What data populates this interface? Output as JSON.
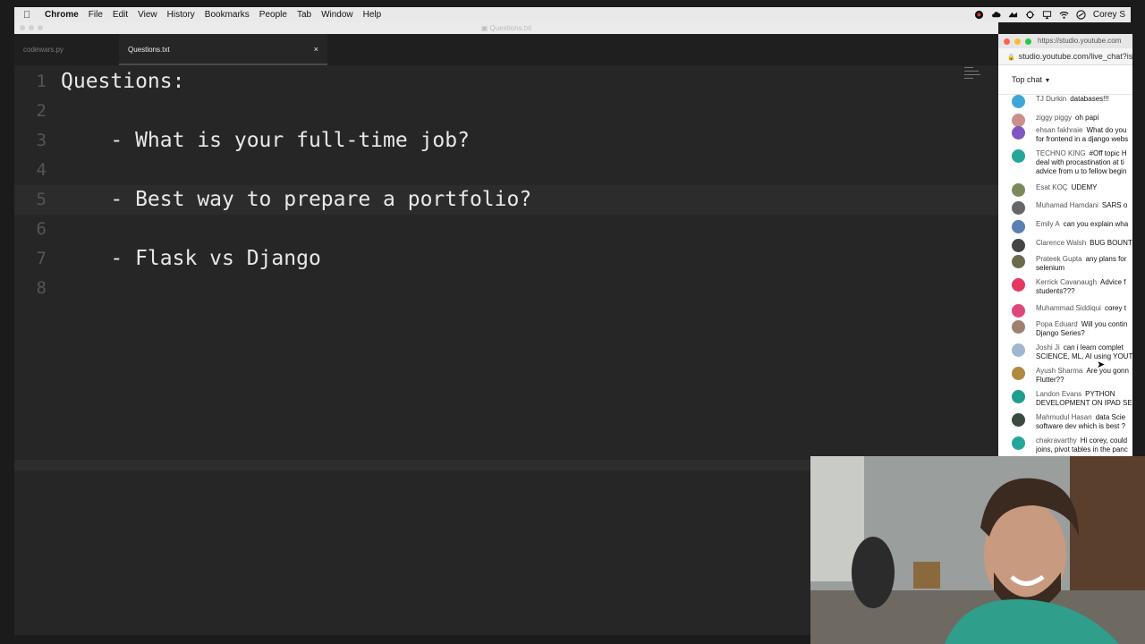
{
  "menubar": {
    "app": "Chrome",
    "items": [
      "File",
      "Edit",
      "View",
      "History",
      "Bookmarks",
      "People",
      "Tab",
      "Window",
      "Help"
    ],
    "user": "Corey S"
  },
  "window": {
    "title": "Questions.txt"
  },
  "tabs": [
    {
      "label": "codewars.py",
      "active": false
    },
    {
      "label": "Questions.txt",
      "active": true
    }
  ],
  "editor": {
    "lines": [
      {
        "num": "1",
        "text": "Questions:"
      },
      {
        "num": "2",
        "text": ""
      },
      {
        "num": "3",
        "text": "    - What is your full-time job?"
      },
      {
        "num": "4",
        "text": ""
      },
      {
        "num": "5",
        "text": "    - Best way to prepare a portfolio?"
      },
      {
        "num": "6",
        "text": ""
      },
      {
        "num": "7",
        "text": "    - Flask vs Django"
      },
      {
        "num": "8",
        "text": ""
      }
    ],
    "current_line": 5
  },
  "chat": {
    "window_url": "https://studio.youtube.com",
    "address": "studio.youtube.com/live_chat?is",
    "header": "Top chat",
    "messages": [
      {
        "author": "TJ Durkin",
        "text": "databases!!!",
        "color": "#3fa7d6"
      },
      {
        "author": "ziggy piggy",
        "text": "oh papi",
        "color": "#c98f8f"
      },
      {
        "author": "ehsan fakhraie",
        "text": "What do you",
        "text2": "for frontend in a django webs",
        "color": "#7e57c2"
      },
      {
        "author": "TECHNO KING",
        "text": "#Off topic H",
        "text2": "deal with procastination at ti",
        "text3": "advice from u to fellow begin",
        "color": "#26a69a"
      },
      {
        "author": "Esat KOÇ",
        "text": "UDEMY",
        "color": "#7a8a5a"
      },
      {
        "author": "Muhamad Hamdani",
        "text": "SARS o",
        "color": "#666666"
      },
      {
        "author": "Emily A",
        "text": "can you explain wha",
        "color": "#5a7fb0"
      },
      {
        "author": "Clarence Walsh",
        "text": "BUG BOUNT",
        "color": "#444444"
      },
      {
        "author": "Prateek Gupta",
        "text": "any plans for",
        "text2": "selenium",
        "color": "#6b6b4b"
      },
      {
        "author": "Kerrick Cavanaugh",
        "text": "Advice f",
        "text2": "students???",
        "color": "#e53961"
      },
      {
        "author": "Muhammad Siddiqui",
        "text": "corey t",
        "color": "#e0457b"
      },
      {
        "author": "Popa Eduard",
        "text": "Will you contin",
        "text2": "Django Series?",
        "color": "#a08070"
      },
      {
        "author": "Joshi Ji",
        "text": "can i learn complet",
        "text2": "SCIENCE, ML, AI using YOUT",
        "color": "#9fb6d0"
      },
      {
        "author": "Ayush Sharma",
        "text": "Are you gonn",
        "text2": "Flutter??",
        "color": "#b08a40"
      },
      {
        "author": "Landon Evans",
        "text": "PYTHON",
        "text2": "DEVELOPMENT ON IPAD SE",
        "color": "#1e9e8e"
      },
      {
        "author": "Mahmudul Hasan",
        "text": "data Scie",
        "text2": "software dev which is best ?",
        "color": "#3a4a40"
      },
      {
        "author": "chakravarthy",
        "text": "Hi corey, could",
        "text2": "joins, pivot tables in the panc",
        "color": "#26a69a"
      }
    ]
  },
  "colors": {
    "editor_bg": "#262626",
    "tab_bar_bg": "#1f1f1f",
    "code_text": "#e8e8e8",
    "line_number": "#555555",
    "menubar_bg": "#e9e9e9"
  }
}
